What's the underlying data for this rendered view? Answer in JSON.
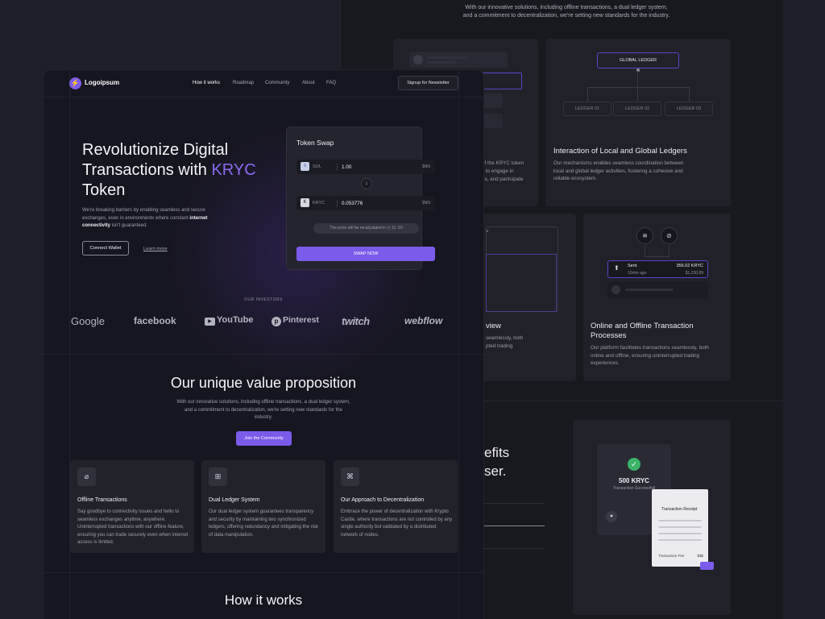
{
  "back_page": {
    "intro": "With our innovative solutions, including offline transactions, a dual ledger system, and a commitment to decentralization, we're setting new standards for the industry.",
    "ledger_card": {
      "global": "GLOBAL LEDGER",
      "ledgers": [
        "LEDGER 01",
        "LEDGER 02",
        "LEDGER 03"
      ],
      "title": "Interaction of Local and Global Ledgers",
      "desc": "Our mechanisms enables seamless coordination between local and global ledger activities, fostering a cohesive and reliable ecosystem."
    },
    "partial_left_text": [
      "of the KRYC token",
      "s to engage in",
      "es, and participate"
    ],
    "partial_view": [
      "view",
      "seamlessly, both",
      "pted trading"
    ],
    "offline_card": {
      "sent_label": "Sent",
      "sent_time": "10min ago",
      "amount": "356.02 KRYC",
      "usd": "$1,230.89",
      "title": "Online and Offline Transaction Processes",
      "desc": "Our platform facilitates transactions seamlessly, both online and offline, ensuring uninterrupted trading experiences."
    },
    "benefits_partial": [
      "efits",
      "ser."
    ],
    "receipt_card": {
      "amount": "500 KRYC",
      "status": "Transaction Successfull",
      "receipt_title": "Transaction Receipt",
      "fee_label": "Transaction Fee",
      "fee_value": "$$$"
    }
  },
  "nav": {
    "logo": "Logoipsum",
    "links": [
      "How it works",
      "Roadmap",
      "Community",
      "About",
      "FAQ"
    ],
    "cta": "Signup for Newsletter"
  },
  "hero": {
    "title_part1": "Revolutionize Digital Transactions with ",
    "title_accent": "KRYC",
    "title_part2": " Token",
    "sub_part1": "We're breaking barriers by enabling seamless and secure exchanges, even in environments where constant ",
    "sub_bold": "internet connectivity",
    "sub_part2": " isn't guaranteed.",
    "connect": "Connect Wallet",
    "learn": "Learn more"
  },
  "swap": {
    "title": "Token Swap",
    "from": {
      "token": "SOL",
      "value": "1.00",
      "usd": "$NN"
    },
    "to": {
      "token": "KRYC",
      "value": "0.053776",
      "usd": "$NN"
    },
    "recalc_label": "The price will be recalculated in",
    "recalc_time": "11 :10",
    "button": "SWAP NOW"
  },
  "investors": {
    "label": "OUR INVESTORS",
    "brands": [
      "Google",
      "facebook",
      "YouTube",
      "Pinterest",
      "twitch",
      "webflow"
    ]
  },
  "value_prop": {
    "title": "Our unique value proposition",
    "sub": "With our innovative solutions, including offline transactions, a dual ledger system, and a commitment to decentralization, we're setting new standards for the industry.",
    "cta": "Join the Community",
    "features": [
      {
        "title": "Offline Transactions",
        "desc": "Say goodbye to connectivity issues and hello to seamless exchanges anytime, anywhere. Uninterrupted transactions with our offline feature, ensuring you can trade securely even when internet access is limited."
      },
      {
        "title": "Dual Ledger System",
        "desc": "Our dual ledger system guarantees transparency and security by maintaining two synchronized ledgers, offering redundancy and mitigating the risk of data manipulation."
      },
      {
        "title": "Our Approach to Decentralization",
        "desc": "Embrace the power of decentralization with Krypto Castle, where transactions are not controlled by any single authority but validated by a distributed network of nodes."
      }
    ]
  },
  "how_it_works": {
    "title": "How it works"
  }
}
